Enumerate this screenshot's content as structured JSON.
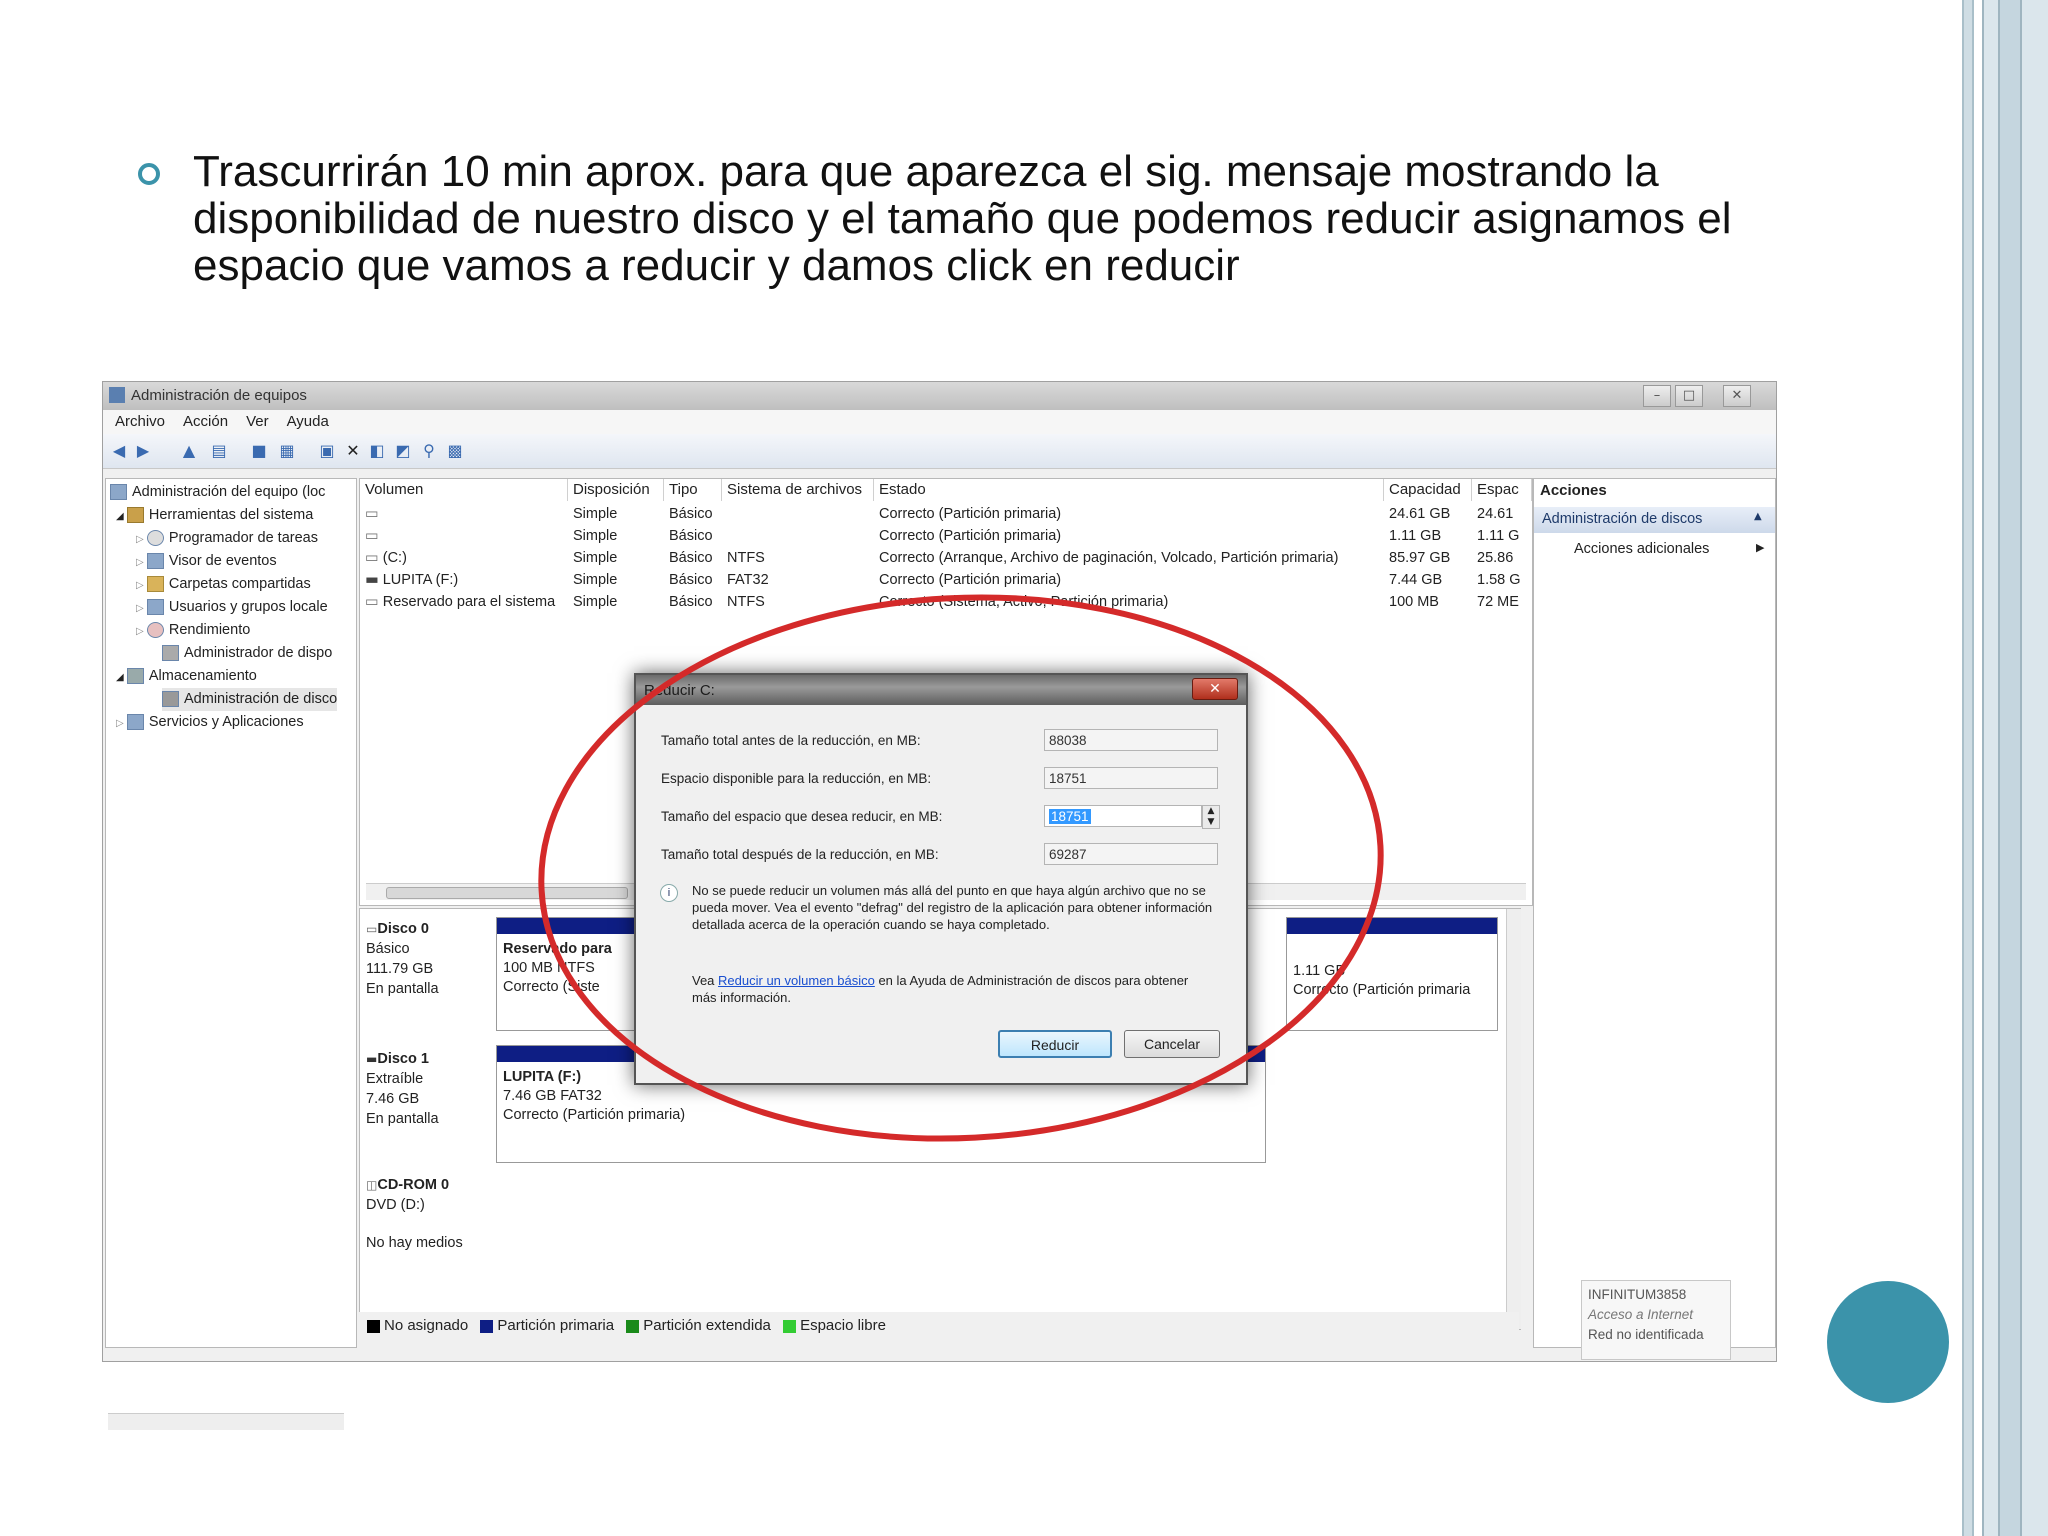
{
  "slide": {
    "bullet": "Trascurrirán 10 min aprox. para que aparezca el sig. mensaje mostrando la disponibilidad de nuestro disco y el tamaño que podemos reducir asignamos el espacio que vamos a reducir y damos click en reducir",
    "accent_color": "#3b93aa"
  },
  "window": {
    "title": "Administración de equipos",
    "menu": [
      "Archivo",
      "Acción",
      "Ver",
      "Ayuda"
    ],
    "tree": [
      {
        "label": "Administración del equipo (loc",
        "level": 0
      },
      {
        "label": "Herramientas del sistema",
        "level": 1
      },
      {
        "label": "Programador de tareas",
        "level": 2
      },
      {
        "label": "Visor de eventos",
        "level": 2
      },
      {
        "label": "Carpetas compartidas",
        "level": 2
      },
      {
        "label": "Usuarios y grupos locale",
        "level": 2
      },
      {
        "label": "Rendimiento",
        "level": 2
      },
      {
        "label": "Administrador de dispo",
        "level": 2
      },
      {
        "label": "Almacenamiento",
        "level": 1
      },
      {
        "label": "Administración de disco",
        "level": 2
      },
      {
        "label": "Servicios y Aplicaciones",
        "level": 1
      }
    ],
    "volume_columns": [
      "Volumen",
      "Disposición",
      "Tipo",
      "Sistema de archivos",
      "Estado",
      "Capacidad",
      "Espac"
    ],
    "volumes": [
      [
        "",
        "Simple",
        "Básico",
        "",
        "Correcto (Partición primaria)",
        "24.61 GB",
        "24.61"
      ],
      [
        "",
        "Simple",
        "Básico",
        "",
        "Correcto (Partición primaria)",
        "1.11 GB",
        "1.11 G"
      ],
      [
        "(C:)",
        "Simple",
        "Básico",
        "NTFS",
        "Correcto (Arranque, Archivo de paginación, Volcado, Partición primaria)",
        "85.97 GB",
        "25.86"
      ],
      [
        "LUPITA (F:)",
        "Simple",
        "Básico",
        "FAT32",
        "Correcto (Partición primaria)",
        "7.44 GB",
        "1.58 G"
      ],
      [
        "Reservado para el sistema",
        "Simple",
        "Básico",
        "NTFS",
        "Correcto (Sistema, Activo, Partición primaria)",
        "100 MB",
        "72 ME"
      ]
    ],
    "disks": [
      {
        "name": "Disco 0",
        "type": "Básico",
        "size": "111.79 GB",
        "status": "En pantalla"
      },
      {
        "name": "Disco 1",
        "type": "Extraíble",
        "size": "7.46 GB",
        "status": "En pantalla"
      },
      {
        "name": "CD-ROM 0",
        "type": "DVD (D:)",
        "size": "",
        "status": "No hay medios"
      }
    ],
    "partitions": {
      "reserved": {
        "name": "Reservado para",
        "size": "100 MB NTFS",
        "status": "Correcto (Siste"
      },
      "right": {
        "size": "1.11 GB",
        "status": "Correcto (Partición primaria"
      },
      "lupita": {
        "name": "LUPITA  (F:)",
        "size": "7.46 GB FAT32",
        "status": "Correcto (Partición primaria)"
      }
    },
    "legend": [
      {
        "label": "No asignado",
        "color": "#000000"
      },
      {
        "label": "Partición primaria",
        "color": "#0e1e84"
      },
      {
        "label": "Partición extendida",
        "color": "#1a8a1a"
      },
      {
        "label": "Espacio libre",
        "color": "#33cc33"
      }
    ],
    "actions": {
      "header": "Acciones",
      "selected": "Administración de discos",
      "more": "Acciones adicionales"
    }
  },
  "dialog": {
    "title": "Reducir C:",
    "fields": [
      {
        "label": "Tamaño total antes de la reducción, en MB:",
        "value": "88038"
      },
      {
        "label": "Espacio disponible para la reducción, en MB:",
        "value": "18751"
      },
      {
        "label": "Tamaño del espacio que desea reducir, en MB:",
        "value": "18751"
      },
      {
        "label": "Tamaño total después de la reducción, en MB:",
        "value": "69287"
      }
    ],
    "info": "No se puede reducir un volumen más allá del punto en que haya algún archivo que no se pueda mover. Vea el evento \"defrag\" del registro de la aplicación para obtener información detallada acerca de la operación cuando se haya completado.",
    "help_prefix": "Vea ",
    "help_link": "Reducir un volumen básico",
    "help_suffix": " en la Ayuda de Administración de discos para obtener más información.",
    "ok_label": "Reducir",
    "cancel_label": "Cancelar",
    "highlight_color": "#d42a2a"
  },
  "notification": {
    "line1": "INFINITUM3858",
    "line2": "Acceso a Internet",
    "line3": "Red no identificada"
  }
}
